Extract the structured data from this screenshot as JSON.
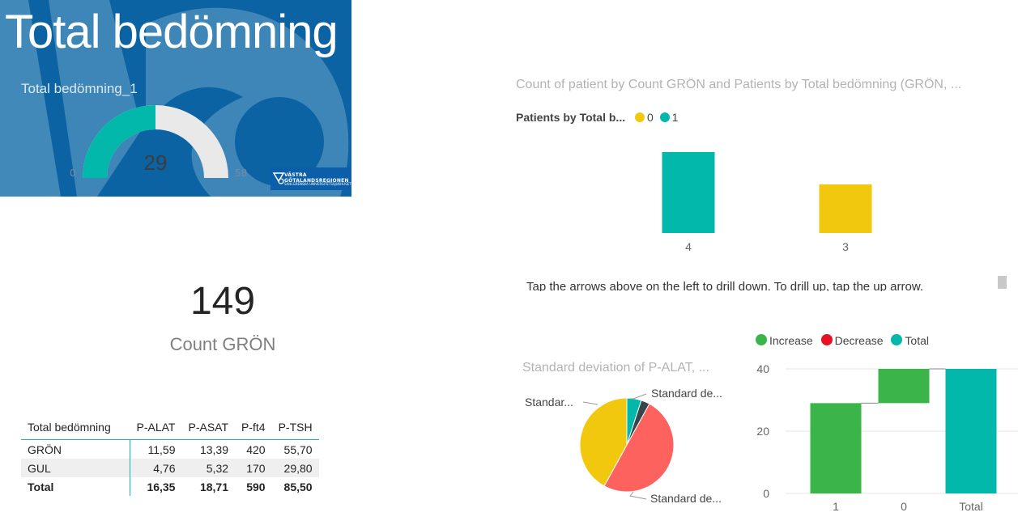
{
  "banner": {
    "title": "Total bedömning",
    "gauge": {
      "title": "Total bedömning_1",
      "value": 29,
      "min": 0,
      "max": 58,
      "value_label": "29",
      "min_label": "0",
      "max_label": "58",
      "fill_color": "#01b8aa",
      "track_color": "#e9e9e9"
    },
    "logo": {
      "line1": "VÄSTRA",
      "line2": "GÖTALANDSREGIONEN",
      "line3": "SAHLGRENSKA UNIVERSITETSSJUKHUSET"
    }
  },
  "card": {
    "value": "149",
    "label": "Count GRÖN"
  },
  "table": {
    "headers": [
      "Total bedömning",
      "P-ALAT",
      "P-ASAT",
      "P-ft4",
      "P-TSH"
    ],
    "rows": [
      [
        "GRÖN",
        "11,59",
        "13,39",
        "420",
        "55,70"
      ],
      [
        "GUL",
        "4,76",
        "5,32",
        "170",
        "29,80"
      ]
    ],
    "total": [
      "Total",
      "16,35",
      "18,71",
      "590",
      "85,50"
    ]
  },
  "column_chart": {
    "title": "Count of patient by Count GRÖN and Patients by Total bedömning (GRÖN, ...",
    "legend_title": "Patients by Total b...",
    "legend": [
      {
        "label": "0",
        "color": "#f2c80f"
      },
      {
        "label": "1",
        "color": "#01b8aa"
      }
    ],
    "drill_text": "Tap the arrows above on the left to drill down. To drill up, tap the up arrow."
  },
  "pie_chart": {
    "title": "Standard deviation of P-ALAT, ...",
    "labels": {
      "left": "Standar...",
      "top": "Standard de...",
      "bottom": "Standard de..."
    }
  },
  "waterfall": {
    "legend": [
      {
        "label": "Increase",
        "color": "#3bb44a"
      },
      {
        "label": "Decrease",
        "color": "#e81123"
      },
      {
        "label": "Total",
        "color": "#01b8aa"
      }
    ]
  },
  "chart_data": [
    {
      "type": "bar",
      "categories": [
        "4",
        "3"
      ],
      "series": [
        {
          "name": "1",
          "values": [
            1,
            0
          ]
        },
        {
          "name": "0",
          "values": [
            0,
            0.6
          ]
        }
      ],
      "colors": [
        "#01b8aa",
        "#f2c80f"
      ],
      "title": "Count of patient by Count GRÖN and Patients by Total bedömning (GRÖN, ..."
    },
    {
      "type": "pie",
      "categories": [
        "Standard de... (teal)",
        "Standard de... (dark)",
        "Standard de... (red)",
        "Standar... (yellow)"
      ],
      "values": [
        0.05,
        0.03,
        0.5,
        0.42
      ],
      "colors": [
        "#01b8aa",
        "#374649",
        "#fd625e",
        "#f2c80f"
      ],
      "title": "Standard deviation of P-ALAT, ..."
    },
    {
      "type": "bar",
      "subtype": "waterfall",
      "categories": [
        "1",
        "0",
        "Total"
      ],
      "values": [
        29,
        11,
        40
      ],
      "kinds": [
        "increase",
        "increase",
        "total"
      ],
      "ylim": [
        0,
        40
      ],
      "yticks": [
        0,
        20,
        40
      ]
    }
  ]
}
